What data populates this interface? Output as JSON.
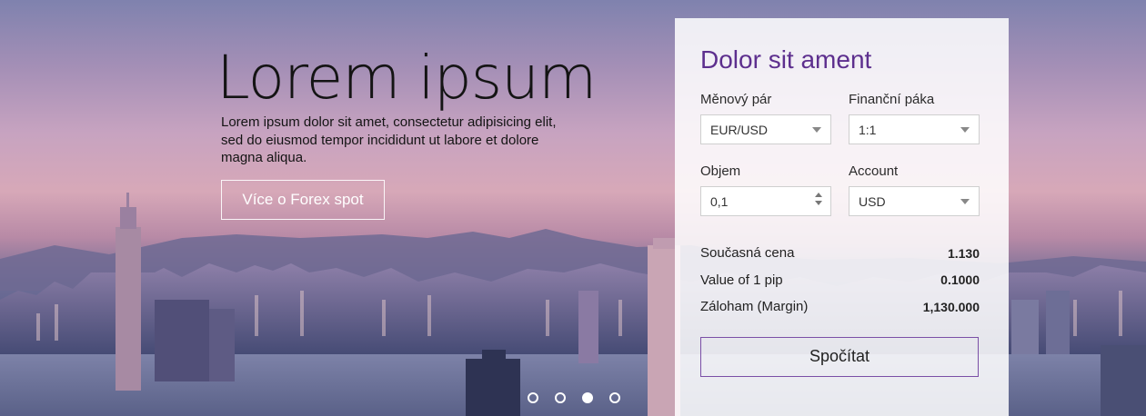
{
  "hero": {
    "headline": "Lorem ipsum",
    "description": "Lorem ipsum dolor sit amet, consectetur adipisicing elit, sed do eiusmod tempor incididunt ut labore et dolore magna aliqua.",
    "cta_label": "Více o Forex spot"
  },
  "carousel": {
    "slide_count": 4,
    "active_index": 2
  },
  "calculator": {
    "title": "Dolor sit ament",
    "currency_pair": {
      "label": "Měnový pár",
      "value": "EUR/USD"
    },
    "leverage": {
      "label": "Finanční páka",
      "value": "1:1"
    },
    "volume": {
      "label": "Objem",
      "value": "0,1"
    },
    "account": {
      "label": "Account",
      "value": "USD"
    },
    "results": [
      {
        "label": "Současná cena",
        "value": "1.130"
      },
      {
        "label": "Value of 1 pip",
        "value": "0.1000"
      },
      {
        "label": "Záloham (Margin)",
        "value": "1,130.000"
      }
    ],
    "submit_label": "Spočítat",
    "accent_color": "#5d2f8e"
  }
}
